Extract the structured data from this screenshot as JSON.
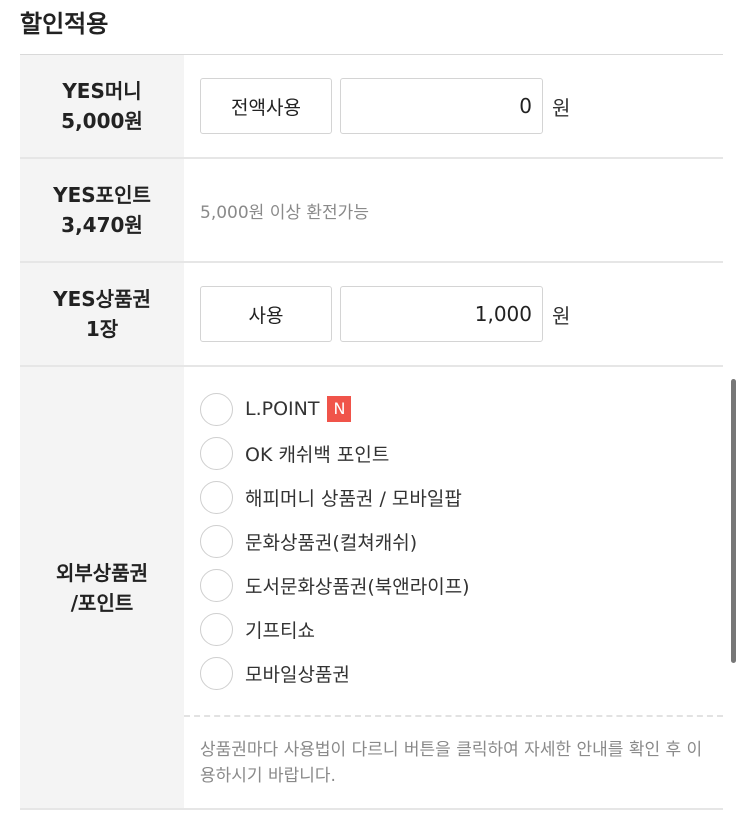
{
  "section": {
    "title": "할인적용"
  },
  "money": {
    "label_line1": "YES머니",
    "label_line2": "5,000원",
    "button_label": "전액사용",
    "amount": "0",
    "unit": "원"
  },
  "point": {
    "label_line1": "YES포인트",
    "label_line2": "3,470원",
    "note": "5,000원 이상 환전가능"
  },
  "gift": {
    "label_line1": "YES상품권",
    "label_line2": "1장",
    "button_label": "사용",
    "amount": "1,000",
    "unit": "원"
  },
  "external": {
    "label_line1": "외부상품권",
    "label_line2": "/포인트",
    "options": [
      {
        "label": "L.POINT",
        "badge": "N"
      },
      {
        "label": "OK 캐쉬백 포인트"
      },
      {
        "label": "해피머니 상품권 / 모바일팝"
      },
      {
        "label": "문화상품권(컬쳐캐쉬)"
      },
      {
        "label": "도서문화상품권(북앤라이프)"
      },
      {
        "label": "기프티쇼"
      },
      {
        "label": "모바일상품권"
      }
    ],
    "notice": "상품권마다 사용법이 다르니 버튼을 클릭하여 자세한 안내를 확인 후 이용하시기 바랍니다."
  },
  "colors": {
    "badge": "#f0544a",
    "label_bg": "#f4f4f4"
  }
}
